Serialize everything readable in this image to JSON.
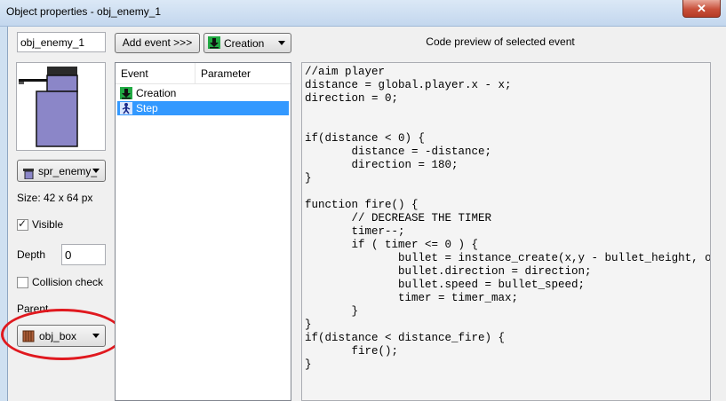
{
  "window": {
    "title": "Object properties - obj_enemy_1",
    "close_glyph": "✕"
  },
  "object": {
    "name": "obj_enemy_1",
    "sprite": "spr_enemy_",
    "size_text": "Size: 42 x 64 px",
    "visible_label": "Visible",
    "visible_checked": true,
    "visible_mark": "✓",
    "depth_label": "Depth",
    "depth_value": "0",
    "collision_label": "Collision check",
    "collision_checked": false,
    "parent_label": "Parent",
    "parent_value": "obj_box"
  },
  "toolbar": {
    "add_event_label": "Add event >>>",
    "event_type_label": "Creation",
    "event_type_icon": "creation-arrow-icon"
  },
  "event_list": {
    "columns": [
      "Event",
      "Parameter"
    ],
    "rows": [
      {
        "label": "Creation",
        "icon": "creation-arrow-icon",
        "selected": false
      },
      {
        "label": "Step",
        "icon": "step-walker-icon",
        "selected": true
      }
    ]
  },
  "code_preview": {
    "title": "Code preview of selected event",
    "code": "//aim player\ndistance = global.player.x - x;\ndirection = 0;\n\n\nif(distance < 0) {\n       distance = -distance;\n       direction = 180;\n}\n\nfunction fire() {\n       // DECREASE THE TIMER\n       timer--;\n       if ( timer <= 0 ) {\n              bullet = instance_create(x,y - bullet_height, obj_e\n              bullet.direction = direction;\n              bullet.speed = bullet_speed;\n              timer = timer_max;\n       }\n}\nif(distance < distance_fire) {\n       fire();\n}"
  },
  "colors": {
    "selection": "#3399ff",
    "sprite_body": "#8b86c8",
    "highlight_ring": "#e0191f"
  }
}
